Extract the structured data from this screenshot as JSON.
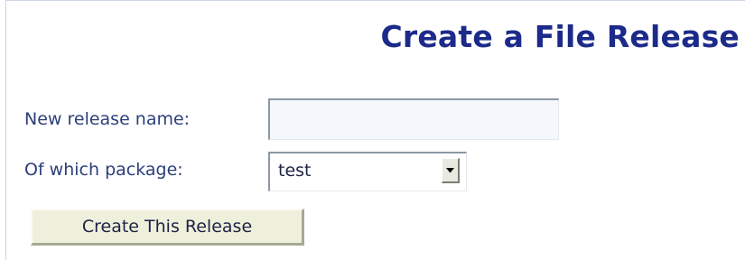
{
  "page": {
    "title": "Create a File Release"
  },
  "form": {
    "release_name_label": "New release name:",
    "release_name_value": "",
    "package_label": "Of which package:",
    "package_selected": "test",
    "submit_label": "Create This Release"
  },
  "icons": {
    "select_arrow": "chevron-down-icon"
  },
  "colors": {
    "title": "#1c2a8a",
    "label": "#2c3f7a",
    "button_bg": "#eff0dc"
  }
}
